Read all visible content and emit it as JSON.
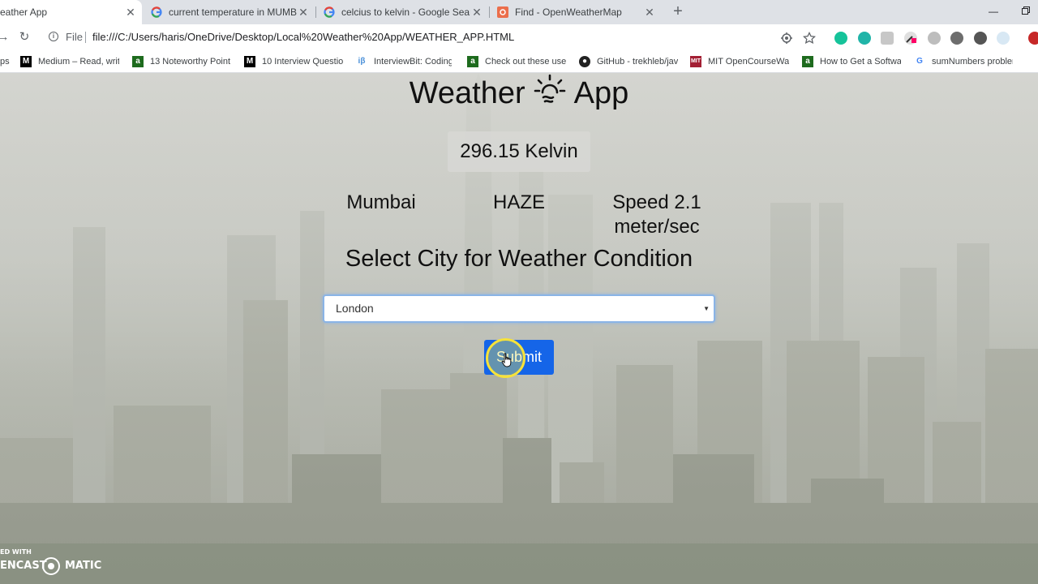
{
  "browser": {
    "tabs": [
      {
        "title": "eather App",
        "active": true,
        "favicon": "page-icon"
      },
      {
        "title": "current temperature in MUMBAI",
        "favicon": "google-icon"
      },
      {
        "title": "celcius to kelvin - Google Search",
        "favicon": "google-icon"
      },
      {
        "title": "Find - OpenWeatherMap",
        "favicon": "openweathermap-icon"
      }
    ],
    "close_glyph": "✕",
    "new_tab_glyph": "+",
    "address": {
      "scheme": "File",
      "url": "file:///C:/Users/haris/OneDrive/Desktop/Local%20Weather%20App/WEATHER_APP.HTML"
    },
    "bookmarks": [
      {
        "label": "ps",
        "icon": "apps-icon"
      },
      {
        "label": "Medium – Read, writ",
        "icon": "medium-icon"
      },
      {
        "label": "13 Noteworthy Point",
        "icon": "bookmark-green-icon"
      },
      {
        "label": "10 Interview Questio",
        "icon": "medium-icon"
      },
      {
        "label": "InterviewBit: Coding",
        "icon": "interviewbit-icon"
      },
      {
        "label": "Check out these usef",
        "icon": "bookmark-green-icon"
      },
      {
        "label": "GitHub - trekhleb/jav",
        "icon": "github-icon"
      },
      {
        "label": "MIT OpenCourseWar",
        "icon": "mit-icon"
      },
      {
        "label": "How to Get a Softwa",
        "icon": "bookmark-green-icon"
      },
      {
        "label": "sumNumbers probler",
        "icon": "google-icon"
      }
    ]
  },
  "app": {
    "title_left": "Weather",
    "title_right": "App",
    "title_icon": "sun-cloud-icon",
    "temperature": "296.15 Kelvin",
    "city": "Mumbai",
    "condition": "HAZE",
    "wind_line1": "Speed 2.1",
    "wind_line2": "meter/sec",
    "select_heading": "Select City for Weather Condition",
    "selected_city": "London",
    "submit_label": "Submit"
  },
  "watermark": {
    "top": "ED WITH",
    "left": "ENCAST",
    "right": "MATIC"
  },
  "colors": {
    "submit": "#1565e8",
    "select_focus": "#8ab4e6",
    "cursor_highlight": "#f6e23a"
  }
}
